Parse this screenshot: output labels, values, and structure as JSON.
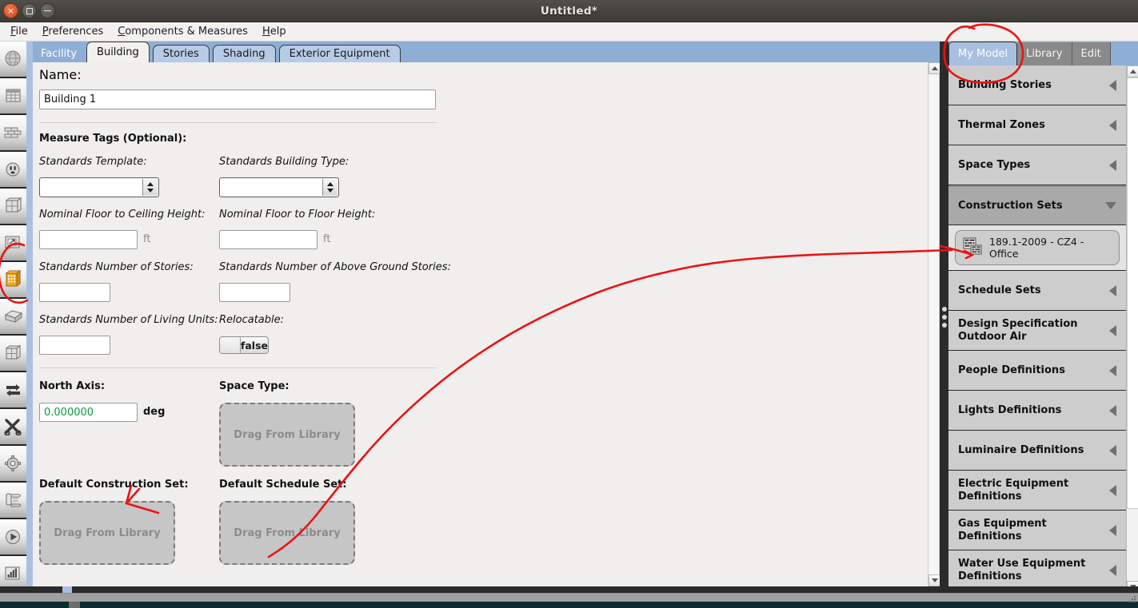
{
  "window": {
    "title": "Untitled*",
    "controls": [
      {
        "name": "close",
        "glyph": "×"
      },
      {
        "name": "maximize",
        "glyph": "□"
      },
      {
        "name": "minimize",
        "glyph": "–"
      }
    ]
  },
  "menubar": {
    "items": [
      {
        "label": "File",
        "mnemonic": "F"
      },
      {
        "label": "Preferences",
        "mnemonic": "P"
      },
      {
        "label": "Components & Measures",
        "mnemonic": "C"
      },
      {
        "label": "Help",
        "mnemonic": "H"
      }
    ]
  },
  "rail": {
    "icons": [
      {
        "name": "site-globe-icon",
        "label": "Site"
      },
      {
        "name": "schedules-calendar-icon",
        "label": "Schedules"
      },
      {
        "name": "constructions-bricks-icon",
        "label": "Constructions"
      },
      {
        "name": "loads-outlet-icon",
        "label": "Loads"
      },
      {
        "name": "space-types-cube-icon",
        "label": "Space Types"
      },
      {
        "name": "geometry-window-icon",
        "label": "Geometry"
      },
      {
        "name": "facility-building-icon",
        "label": "Facility",
        "highlight": true
      },
      {
        "name": "spaces-box-icon",
        "label": "Spaces"
      },
      {
        "name": "thermal-zones-cube-icon",
        "label": "Thermal Zones"
      },
      {
        "name": "hvac-systems-arrows-icon",
        "label": "HVAC Systems"
      },
      {
        "name": "measures-shears-icon",
        "label": "Measures"
      },
      {
        "name": "simulation-settings-gear-icon",
        "label": "Simulation Settings"
      },
      {
        "name": "output-variables-scroll-icon",
        "label": "Output Variables"
      },
      {
        "name": "run-simulation-play-icon",
        "label": "Run Simulation"
      },
      {
        "name": "results-summary-chart-icon",
        "label": "Results Summary"
      }
    ]
  },
  "main_tabs": {
    "items": [
      {
        "label": "Facility",
        "state": "heading"
      },
      {
        "label": "Building",
        "state": "selected"
      },
      {
        "label": "Stories",
        "state": "normal"
      },
      {
        "label": "Shading",
        "state": "normal"
      },
      {
        "label": "Exterior Equipment",
        "state": "normal"
      }
    ]
  },
  "form": {
    "name_section": {
      "label": "Name:",
      "value": "Building 1"
    },
    "measure_tags": {
      "heading": "Measure Tags (Optional):",
      "fields": [
        {
          "label": "Standards Template:",
          "type": "combo",
          "value": ""
        },
        {
          "label": "Standards Building Type:",
          "type": "combo",
          "value": ""
        },
        {
          "label": "Nominal Floor to Ceiling Height:",
          "type": "text",
          "value": "",
          "unit": "ft"
        },
        {
          "label": "Nominal Floor to Floor Height:",
          "type": "text",
          "value": "",
          "unit": "ft"
        },
        {
          "label": "Standards Number of Stories:",
          "type": "text",
          "value": ""
        },
        {
          "label": "Standards Number of Above Ground Stories:",
          "type": "text",
          "value": ""
        },
        {
          "label": "Standards Number of Living Units:",
          "type": "text",
          "value": ""
        },
        {
          "label": "Relocatable:",
          "type": "toggle",
          "value": "false"
        }
      ]
    },
    "north_axis": {
      "label": "North Axis:",
      "value": "0.000000",
      "unit": "deg"
    },
    "space_type": {
      "label": "Space Type:",
      "drop_text": "Drag From Library"
    },
    "default_construction_set": {
      "label": "Default Construction Set:",
      "drop_text": "Drag From Library"
    },
    "default_schedule_set": {
      "label": "Default Schedule Set:",
      "drop_text": "Drag From Library"
    }
  },
  "right_panel": {
    "tabs": [
      {
        "label": "My Model",
        "state": "active"
      },
      {
        "label": "Library",
        "state": "normal"
      },
      {
        "label": "Edit",
        "state": "normal"
      }
    ],
    "sections": [
      {
        "title": "Building Stories",
        "expanded": false
      },
      {
        "title": "Thermal Zones",
        "expanded": false
      },
      {
        "title": "Space Types",
        "expanded": false
      },
      {
        "title": "Construction Sets",
        "expanded": true,
        "items": [
          {
            "label": "189.1-2009 - CZ4 - Office",
            "icon": "bricks-icon"
          }
        ]
      },
      {
        "title": "Schedule Sets",
        "expanded": false
      },
      {
        "title": "Design Specification Outdoor Air",
        "expanded": false
      },
      {
        "title": "People Definitions",
        "expanded": false
      },
      {
        "title": "Lights Definitions",
        "expanded": false
      },
      {
        "title": "Luminaire Definitions",
        "expanded": false
      },
      {
        "title": "Electric Equipment Definitions",
        "expanded": false
      },
      {
        "title": "Gas Equipment Definitions",
        "expanded": false
      },
      {
        "title": "Water Use Equipment Definitions",
        "expanded": false
      }
    ]
  },
  "annotations": {
    "color": "#ee1111",
    "marks": [
      {
        "name": "circle-my-model-tab",
        "shape": "ellipse"
      },
      {
        "name": "circle-facility-rail-icon",
        "shape": "ellipse"
      },
      {
        "name": "arrow-construction-set-to-drop-target",
        "shape": "arrow"
      },
      {
        "name": "arrow-pointer-to-library-item",
        "shape": "arrow"
      }
    ]
  },
  "colors": {
    "accent_blue": "#8eaed6",
    "tab_selected": "#f2f1f0",
    "panel_gray": "#c9c9c9",
    "rail_dark": "#2b2b2b",
    "green_value": "#0a9b3c",
    "annotation_red": "#ee1111"
  }
}
